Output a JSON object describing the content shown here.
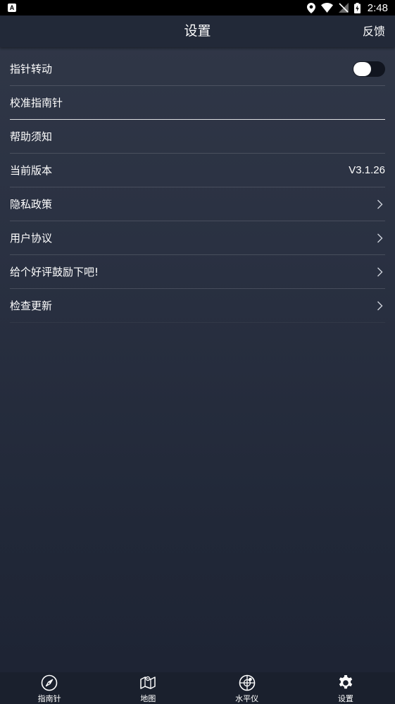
{
  "status_bar": {
    "notification_icon": "A",
    "time": "2:48",
    "icons": [
      "location-icon",
      "wifi-icon",
      "no-sim-icon",
      "battery-charging-icon"
    ]
  },
  "header": {
    "title": "设置",
    "feedback_label": "反馈"
  },
  "settings": {
    "pointer_rotation": {
      "label": "指针转动",
      "toggle_on": false
    },
    "calibrate": {
      "label": "校准指南针"
    },
    "help": {
      "label": "帮助须知"
    },
    "version": {
      "label": "当前版本",
      "value": "V3.1.26"
    },
    "privacy": {
      "label": "隐私政策"
    },
    "user_agreement": {
      "label": "用户协议"
    },
    "rate": {
      "label": "给个好评鼓励下吧!"
    },
    "check_update": {
      "label": "检查更新"
    }
  },
  "bottom_nav": {
    "compass": {
      "label": "指南针",
      "icon": "compass-icon"
    },
    "map": {
      "label": "地图",
      "icon": "map-icon"
    },
    "level": {
      "label": "水平仪",
      "icon": "level-icon"
    },
    "settings": {
      "label": "设置",
      "icon": "gear-icon",
      "active": true
    }
  },
  "colors": {
    "background_top": "#313848",
    "background_bottom": "#1d2333",
    "header_bg": "#222938",
    "nav_bg": "#1a202d",
    "text": "#ffffff"
  }
}
